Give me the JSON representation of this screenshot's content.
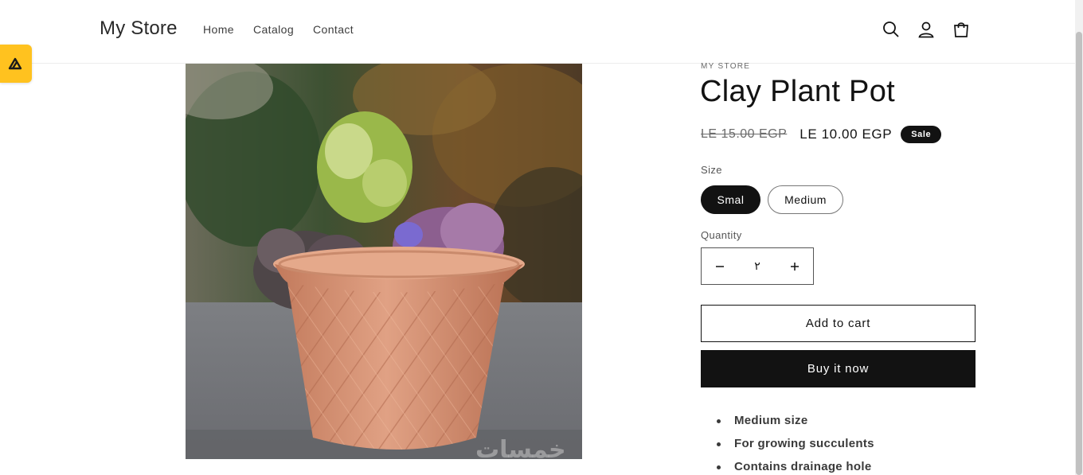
{
  "header": {
    "brand": "My Store",
    "nav": [
      {
        "label": "Home"
      },
      {
        "label": "Catalog"
      },
      {
        "label": "Contact"
      }
    ],
    "icons": [
      "search-icon",
      "account-icon",
      "cart-icon"
    ]
  },
  "product": {
    "vendor": "MY STORE",
    "title": "Clay Plant Pot",
    "price_old": "LE 15.00 EGP",
    "price_new": "LE 10.00 EGP",
    "sale_badge": "Sale",
    "size_label": "Size",
    "sizes": [
      {
        "label": "Smal",
        "selected": true
      },
      {
        "label": "Medium",
        "selected": false
      }
    ],
    "quantity_label": "Quantity",
    "quantity_value": "٢",
    "add_to_cart": "Add to cart",
    "buy_now": "Buy it now",
    "features": [
      "Medium size",
      "For growing succulents",
      "Contains drainage hole"
    ]
  },
  "image": {
    "alt": "terracotta pot with plants",
    "watermark": "خمسات"
  },
  "colors": {
    "accent": "#121212",
    "badge": "#ffc21f",
    "pot": "#d9977a"
  }
}
